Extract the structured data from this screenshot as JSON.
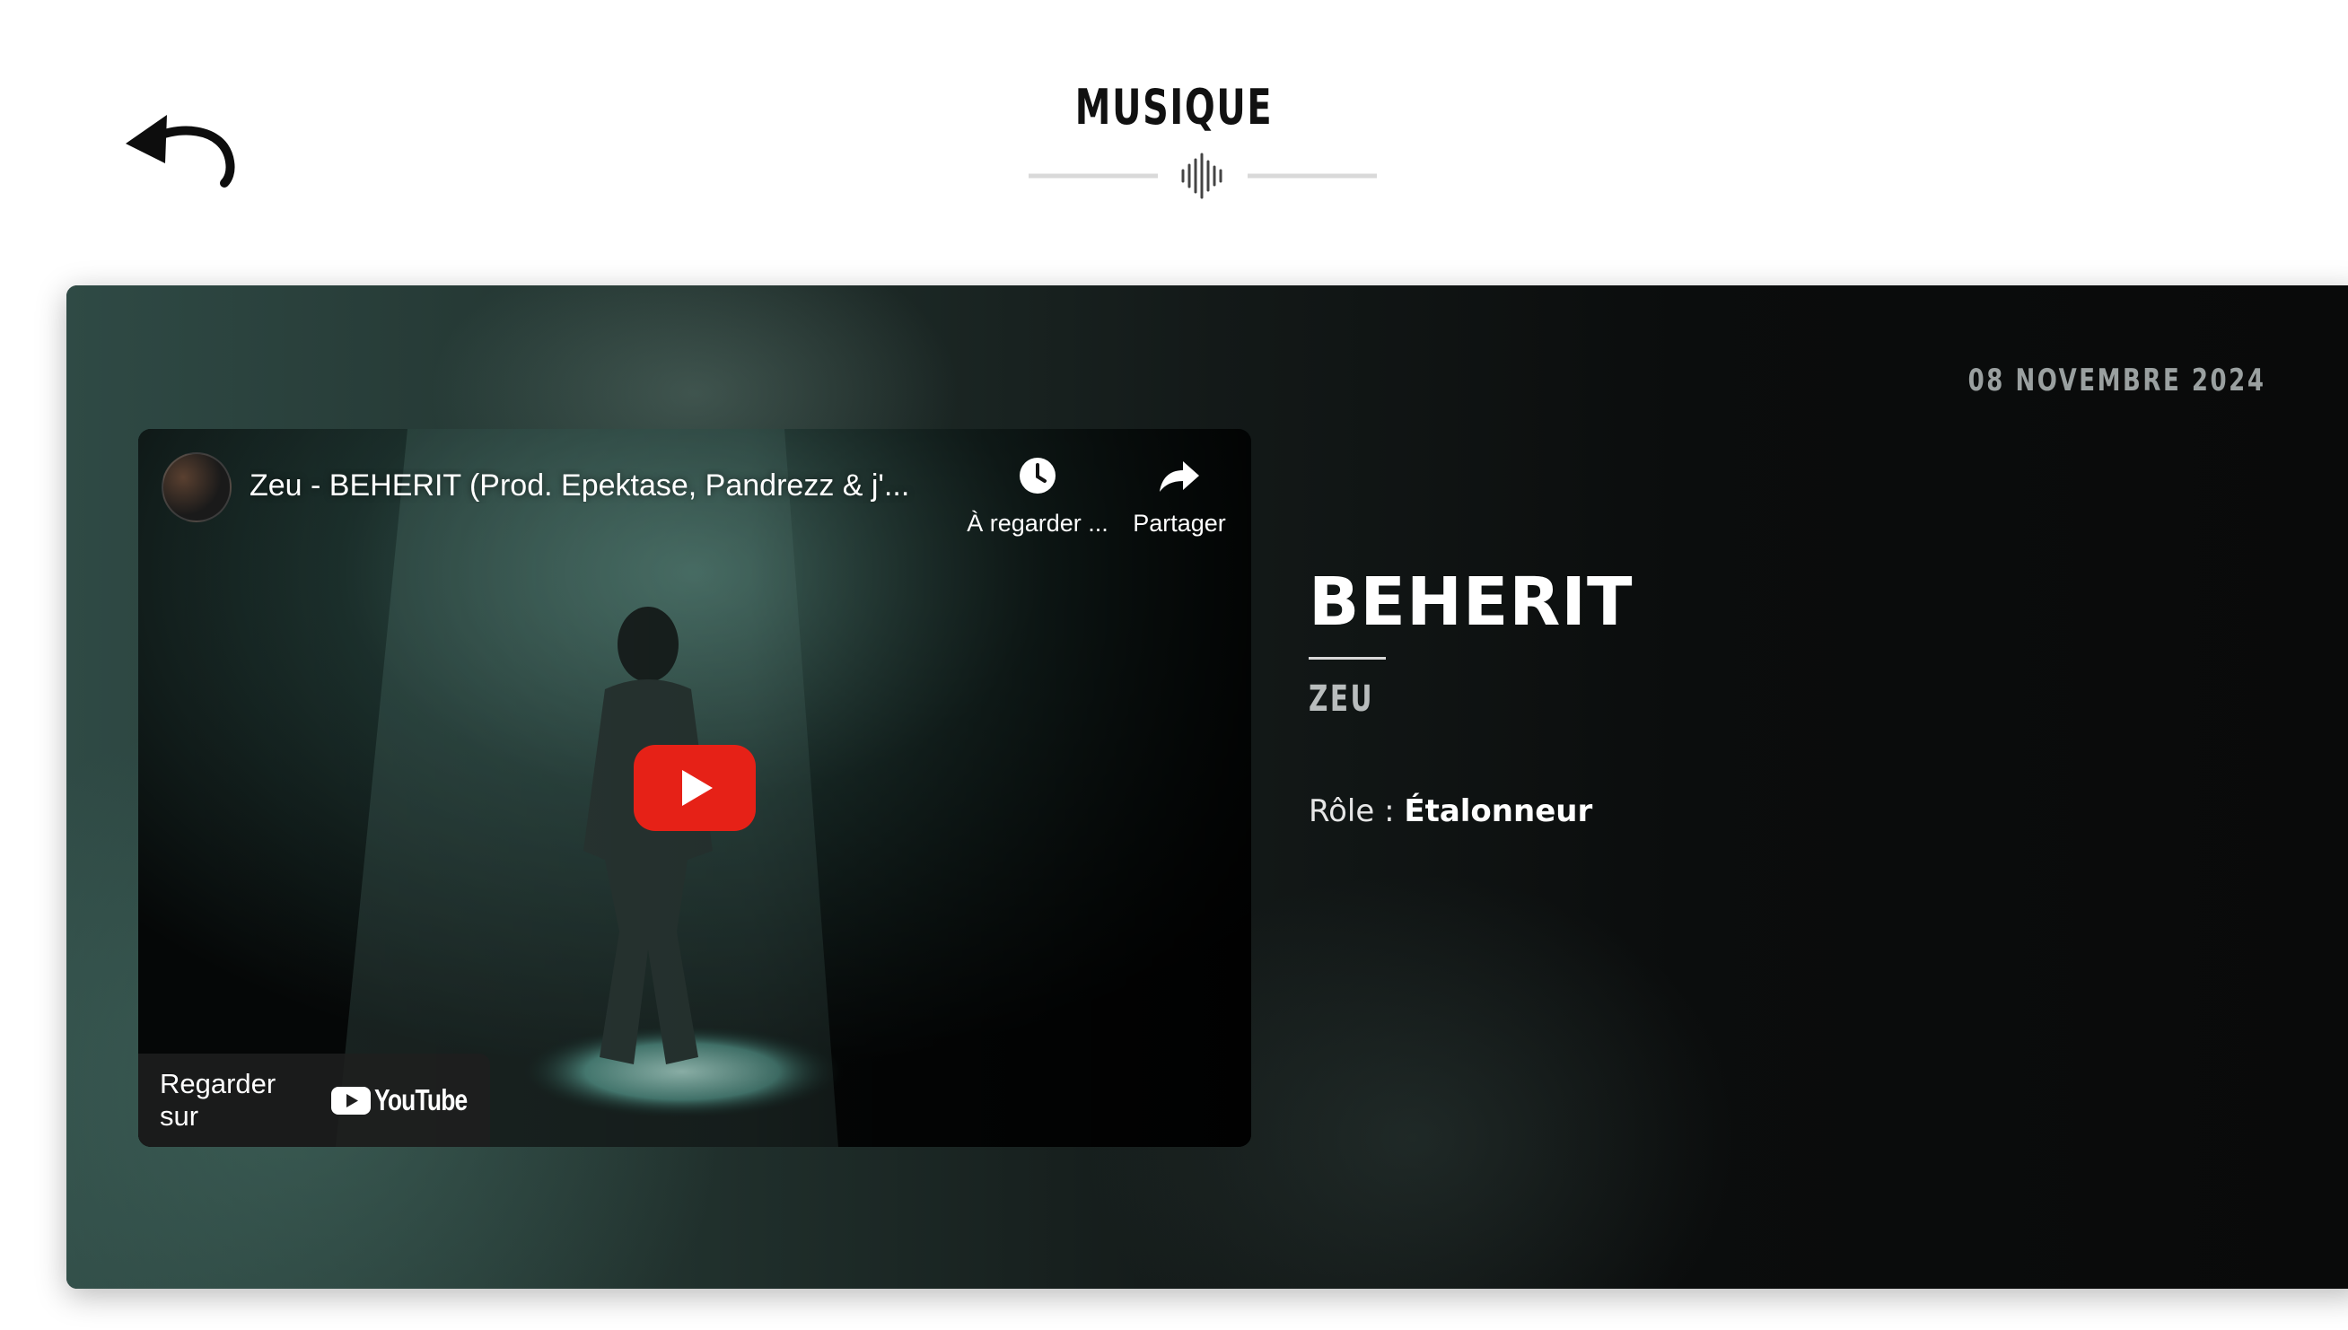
{
  "header": {
    "title": "MUSIQUE",
    "back_icon": "back-arrow-icon",
    "divider_icon": "sound-wave-icon"
  },
  "project": {
    "date": "08 NOVEMBRE 2024",
    "title": "BEHERIT",
    "artist": "ZEU",
    "role_label": "Rôle :",
    "role_value": "Étalonneur"
  },
  "video": {
    "title": "Zeu - BEHERIT (Prod. Epektase, Pandrezz & j'...",
    "watch_later_label": "À regarder ...",
    "share_label": "Partager",
    "watch_on_label": "Regarder sur",
    "youtube_label": "YouTube",
    "watch_later_icon": "clock-icon",
    "share_icon": "share-arrow-icon",
    "play_icon": "play-icon"
  },
  "colors": {
    "page_background": "#ffffff",
    "title_color": "#111111",
    "card_background": "#0b0d0d",
    "youtube_red": "#e62117",
    "date_color": "#9aa0a0",
    "artist_color": "#b9bdbd"
  }
}
